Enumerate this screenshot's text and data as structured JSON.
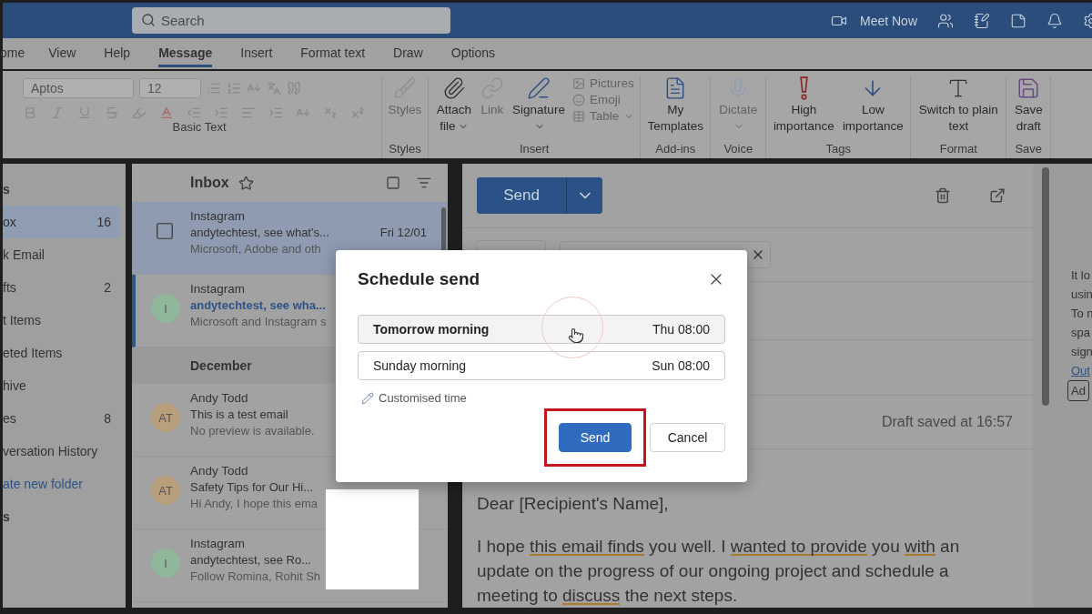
{
  "top_bar": {
    "search": {
      "placeholder": "Search"
    },
    "actions": [
      {
        "kind": "video",
        "label": "Meet Now"
      },
      {
        "kind": "teams"
      },
      {
        "kind": "notebook"
      },
      {
        "kind": "note"
      },
      {
        "kind": "bell"
      },
      {
        "kind": "gear"
      }
    ]
  },
  "ribbon_tabs": [
    {
      "label": "ome",
      "selected": false
    },
    {
      "label": "View",
      "selected": false
    },
    {
      "label": "Help",
      "selected": false
    },
    {
      "label": "Message",
      "selected": true
    },
    {
      "label": "Insert",
      "selected": false
    },
    {
      "label": "Format text",
      "selected": false
    },
    {
      "label": "Draw",
      "selected": false
    },
    {
      "label": "Options",
      "selected": false
    }
  ],
  "ribbon_groups": [
    {
      "kind": "text",
      "label": "Basic Text",
      "font": "Aptos",
      "size": "12"
    },
    {
      "kind": "buttons",
      "label": "Styles",
      "buttons": [
        {
          "kind": "styles",
          "label": "Styles",
          "disabled": true,
          "menu": false
        }
      ]
    },
    {
      "kind": "buttons",
      "label": "Insert",
      "buttons": [
        {
          "kind": "attach",
          "label": "Attach file",
          "disabled": false,
          "menu": true
        },
        {
          "kind": "link",
          "label": "Link",
          "disabled": true,
          "menu": false
        },
        {
          "kind": "signature",
          "label": "Signature",
          "disabled": false,
          "menu": true
        }
      ],
      "small": [
        {
          "kind": "pictures",
          "label": "Pictures",
          "disabled": true,
          "menu": false
        },
        {
          "kind": "emoji",
          "label": "Emoji",
          "disabled": true,
          "menu": false
        },
        {
          "kind": "table",
          "label": "Table",
          "disabled": true,
          "menu": true
        }
      ]
    },
    {
      "kind": "buttons",
      "label": "Add-ins",
      "buttons": [
        {
          "kind": "templates",
          "label": "My Templates",
          "disabled": false,
          "menu": false
        }
      ]
    },
    {
      "kind": "buttons",
      "label": "Voice",
      "buttons": [
        {
          "kind": "dictate",
          "label": "Dictate",
          "disabled": true,
          "menu": true
        }
      ]
    },
    {
      "kind": "buttons",
      "label": "Tags",
      "buttons": [
        {
          "kind": "high",
          "label": "High importance",
          "disabled": false,
          "menu": false
        },
        {
          "kind": "low",
          "label": "Low importance",
          "disabled": false,
          "menu": false
        }
      ]
    },
    {
      "kind": "buttons",
      "label": "Format",
      "buttons": [
        {
          "kind": "plain",
          "label": "Switch to plain text",
          "disabled": false,
          "menu": false
        }
      ]
    },
    {
      "kind": "buttons",
      "label": "Save",
      "buttons": [
        {
          "kind": "save",
          "label": "Save draft",
          "disabled": false,
          "menu": false
        }
      ]
    }
  ],
  "nav": [
    {
      "kind": "heading",
      "label": "s",
      "selected": false
    },
    {
      "kind": "folder",
      "label": "ox",
      "count": "16",
      "selected": true
    },
    {
      "kind": "folder",
      "label": "k Email",
      "selected": false
    },
    {
      "kind": "folder",
      "label": "fts",
      "count": "2",
      "selected": false
    },
    {
      "kind": "folder",
      "label": "t Items",
      "selected": false
    },
    {
      "kind": "folder",
      "label": "eted Items",
      "selected": false
    },
    {
      "kind": "folder",
      "label": "hive",
      "selected": false
    },
    {
      "kind": "folder",
      "label": "es",
      "count": "8",
      "selected": false
    },
    {
      "kind": "folder",
      "label": "versation History",
      "selected": false
    },
    {
      "kind": "link",
      "label": "ate new folder",
      "selected": false
    },
    {
      "kind": "heading",
      "label": "s",
      "selected": false
    }
  ],
  "message_list": {
    "title": "Inbox",
    "items": [
      {
        "kind": "message",
        "sender": "Instagram",
        "subject": "andytechtest, see what's...",
        "date": "Fri 12/01",
        "preview": "Microsoft, Adobe and oth",
        "selected": true,
        "unread": false,
        "checkbox": true
      },
      {
        "kind": "message",
        "initials": "I",
        "color": "#8fb89a",
        "sender": "Instagram",
        "subject": "andytechtest, see wha...",
        "preview": "Microsoft and Instagram s",
        "selected": false,
        "unread": true,
        "checkbox": false
      },
      {
        "kind": "section",
        "label": "December"
      },
      {
        "kind": "message",
        "initials": "AT",
        "color": "#b8a07c",
        "sender": "Andy Todd",
        "subject": "This is a test email",
        "preview": "No preview is available.",
        "selected": false,
        "unread": false,
        "checkbox": false
      },
      {
        "kind": "message",
        "initials": "AT",
        "color": "#b8a07c",
        "sender": "Andy Todd",
        "subject": "Safety Tips for Our Hi...",
        "preview": "Hi Andy, I hope this ema",
        "selected": false,
        "unread": false,
        "checkbox": false
      },
      {
        "kind": "message",
        "initials": "I",
        "color": "#8fb89a",
        "sender": "Instagram",
        "subject": "andytechtest, see Ro...",
        "preview": "Follow Romina, Rohit Sh",
        "selected": false,
        "unread": false,
        "checkbox": false
      }
    ]
  },
  "compose": {
    "send_label": "Send",
    "draft_status": "Draft saved at 16:57",
    "greeting": "Dear [Recipient's Name],",
    "paragraph": [
      {
        "text": "I hope ",
        "flagged": false
      },
      {
        "text": "this email finds",
        "flagged": true
      },
      {
        "text": " you well. I ",
        "flagged": false
      },
      {
        "text": "wanted to provide",
        "flagged": true
      },
      {
        "text": " you ",
        "flagged": false
      },
      {
        "text": "with",
        "flagged": true
      },
      {
        "text": " an update on the progress of our ongoing project and schedule a meeting to ",
        "flagged": false
      },
      {
        "text": "discuss",
        "flagged": true
      },
      {
        "text": " the next steps.",
        "flagged": false
      }
    ]
  },
  "ad_panel": {
    "lines": [
      "It lo",
      "usin",
      "To n",
      "spa",
      "sign"
    ],
    "link": "Out",
    "badge": "Ad"
  },
  "dialog": {
    "title": "Schedule send",
    "options": [
      {
        "label": "Tomorrow morning",
        "time": "Thu 08:00",
        "selected": true
      },
      {
        "label": "Sunday morning",
        "time": "Sun 08:00",
        "selected": false
      }
    ],
    "custom": "Customised time",
    "buttons": [
      {
        "kind": "primary",
        "label": "Send",
        "highlighted": true
      },
      {
        "kind": "secondary",
        "label": "Cancel",
        "highlighted": false
      }
    ]
  }
}
